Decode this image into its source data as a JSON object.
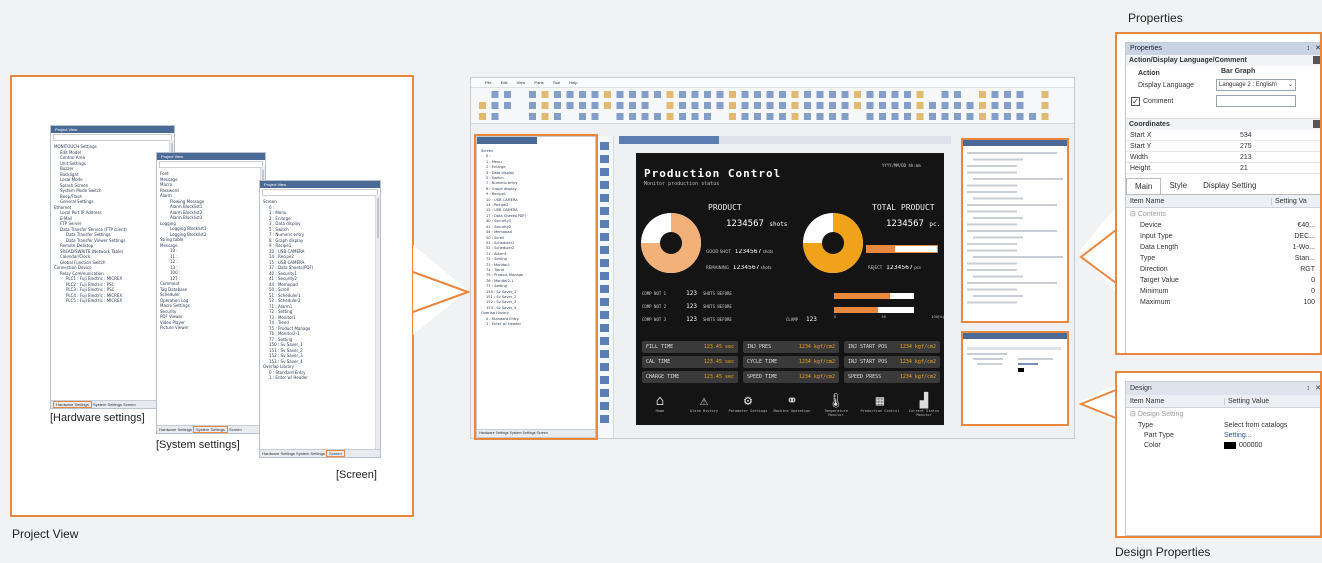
{
  "project_view": {
    "caption": "Project View",
    "label_hardware": "[Hardware settings]",
    "label_system": "[System settings]",
    "label_screen": "[Screen]",
    "win_title": "Project View",
    "hw_items": [
      "MONITOUCH Settings",
      "Edit Model",
      "Control Area",
      "Unit Settings",
      "Buzzer",
      "Backlight",
      "Local Mode",
      "Splash Screen",
      "System Mode Switch",
      "Beep/Flash",
      "General Settings",
      "Ethernet",
      "Local Port IP Address",
      "E-Mail",
      "FTP Server",
      "Data Transfer Service (FTP client)",
      "Data Transfer Settings",
      "Data Transfer Viewer Settings",
      "Remote Desktop",
      "SREAD/SWRITE (Network Table)",
      "Calendar/Clock",
      "Global Function Switch",
      "Connection Device",
      "Relay Communication",
      "PLC1 : Fuji Electric : MICREX",
      "PLC2 : Fuji Electric : PSC",
      "PLC3 : Fuji Electric : PSC",
      "PLC4 : Fuji Electric : MICREX",
      "PLC5 : Fuji Electric : MICREX"
    ],
    "sys_items": [
      "Font",
      "Message",
      "Macro",
      "Password",
      "Alarm",
      "Flowing Message",
      "Alarm Blocklist1",
      "Alarm Blocklist2",
      "Alarm Blocklist3",
      "Logging",
      "Logging Blocklist1",
      "Logging Blocklist2",
      "String table",
      "Message",
      "10 :",
      "11 :",
      "12 :",
      "13 :",
      "100 :",
      "127 :",
      "Comment",
      "Tag Database",
      "Scheduler",
      "Operation Log",
      "Macro Settings",
      "Security",
      "PDF Viewer",
      "Video Player",
      "Picture Viewer"
    ],
    "scr_items": [
      "Screen",
      "0 :",
      "1 : Menu",
      "2 : Enlarge",
      "3 : Data display",
      "5 : Switch",
      "7 : Numeric entry",
      "8 : Graph display",
      "9 : Recipe1",
      "10 : USB CAMERA",
      "14 : Recipe2",
      "15 : USB CAMERA",
      "17 : Data Sheets(PDF)",
      "40 : Security1",
      "41 : Security2",
      "44 : Memopad",
      "50 : Scroll",
      "51 : Scheduler1",
      "52 : Scheduler2",
      "71 : Alarm1",
      "72 : Setting",
      "73 : Monitor1",
      "74 : Trend",
      "75 : Product Manage",
      "76 : Monitor2-1",
      "77 : Setting",
      "150 : Sv Saver_1",
      "151 : Sv Saver_2",
      "152 : Sv Saver_3",
      "153 : Sv Saver_4",
      "Overlap Library",
      "0 : Standard Entry",
      "1 : Enter w/ Header"
    ],
    "tabs_hw": [
      "Hardware Settings",
      "System Settings",
      "Screen"
    ],
    "tabs_sys": [
      "Hardware Settings",
      "System Settings",
      "Screen"
    ],
    "tabs_scr": [
      "Hardware Settings",
      "System Settings",
      "Screen"
    ]
  },
  "editor": {
    "menu": [
      "File",
      "Edit",
      "View",
      "Parts",
      "Tool",
      "Help"
    ],
    "screen_title": "Production Control",
    "screen_subtitle": "Monitor production status",
    "datetime": "YYYY/MM/DD hh:mm",
    "product_label": "PRODUCT",
    "total_label": "TOTAL PRODUCT",
    "product_value": "1234567",
    "product_unit": "shots",
    "total_value": "1234567",
    "total_unit": "pc.",
    "good_shot": "GOOD SHOT",
    "remaining": "REMAINING",
    "reject": "REJECT",
    "row_value": "1234567",
    "shots": "shots",
    "pcs": "pcs",
    "comp_rows": [
      "COMP NOT 1",
      "COMP NOT 2",
      "COMP NOT 3"
    ],
    "comp_val": "123",
    "shots_before": "SHOTS BEFORE",
    "clamp": "CLAMP",
    "time_rows": [
      "FILL TIME",
      "CAL TIME",
      "CHARGE TIME"
    ],
    "time_val": "123.45 sec",
    "press_rows": [
      "INJ PRES",
      "CYCLE TIME",
      "SPEED TIME"
    ],
    "press_val": "1234 kgf/cm2",
    "start_rows": [
      "INJ START POS",
      "INJ START POS",
      "SPEED PRESS"
    ],
    "icons": [
      "Home",
      "Alarm History",
      "Parameter Settings",
      "Machine Operation",
      "Temperature Monitor",
      "Production Control",
      "Current Status Monitor"
    ],
    "bar_ticks": [
      "0",
      "50",
      "100(%)"
    ]
  },
  "properties": {
    "caption": "Properties",
    "win_title": "Properties",
    "section_action": "Action/Display Language/Comment",
    "action_label": "Action",
    "action_value": "Bar Graph",
    "lang_label": "Display Language",
    "lang_value": "Language 2 : English\\",
    "comment_label": "Comment",
    "coord_title": "Coordinates",
    "coords": [
      {
        "k": "Start X",
        "v": "534"
      },
      {
        "k": "Start Y",
        "v": "275"
      },
      {
        "k": "Width",
        "v": "213"
      },
      {
        "k": "Height",
        "v": "21"
      }
    ],
    "tabs": [
      "Main",
      "Style",
      "Display Setting"
    ],
    "col_item": "Item Name",
    "col_value": "Setting Va",
    "group": "Contents",
    "rows": [
      {
        "k": "Device",
        "v": "€40..."
      },
      {
        "k": "Input Type",
        "v": "DEC..."
      },
      {
        "k": "Data Length",
        "v": "1-Wo..."
      },
      {
        "k": "Type",
        "v": "Stan..."
      },
      {
        "k": "Direction",
        "v": "RGT"
      },
      {
        "k": "Target Value",
        "v": "0"
      },
      {
        "k": "Minimum",
        "v": "0"
      },
      {
        "k": "Maximum",
        "v": "100"
      }
    ]
  },
  "design": {
    "caption": "Design Properties",
    "win_title": "Design",
    "col_item": "Item Name",
    "col_value": "Setting Value",
    "group": "Design Setting",
    "type_label": "Type",
    "type_value": "Select from catalogs",
    "part_label": "Part Type",
    "part_value": "Setting...",
    "color_label": "Color",
    "color_value": "000000"
  },
  "colors": {
    "accent": "#e9873f",
    "dark_bg": "#141414",
    "title_blue": "#4b6a96",
    "pie_light": "#f2b179",
    "pie_gold": "#f0a21a"
  }
}
